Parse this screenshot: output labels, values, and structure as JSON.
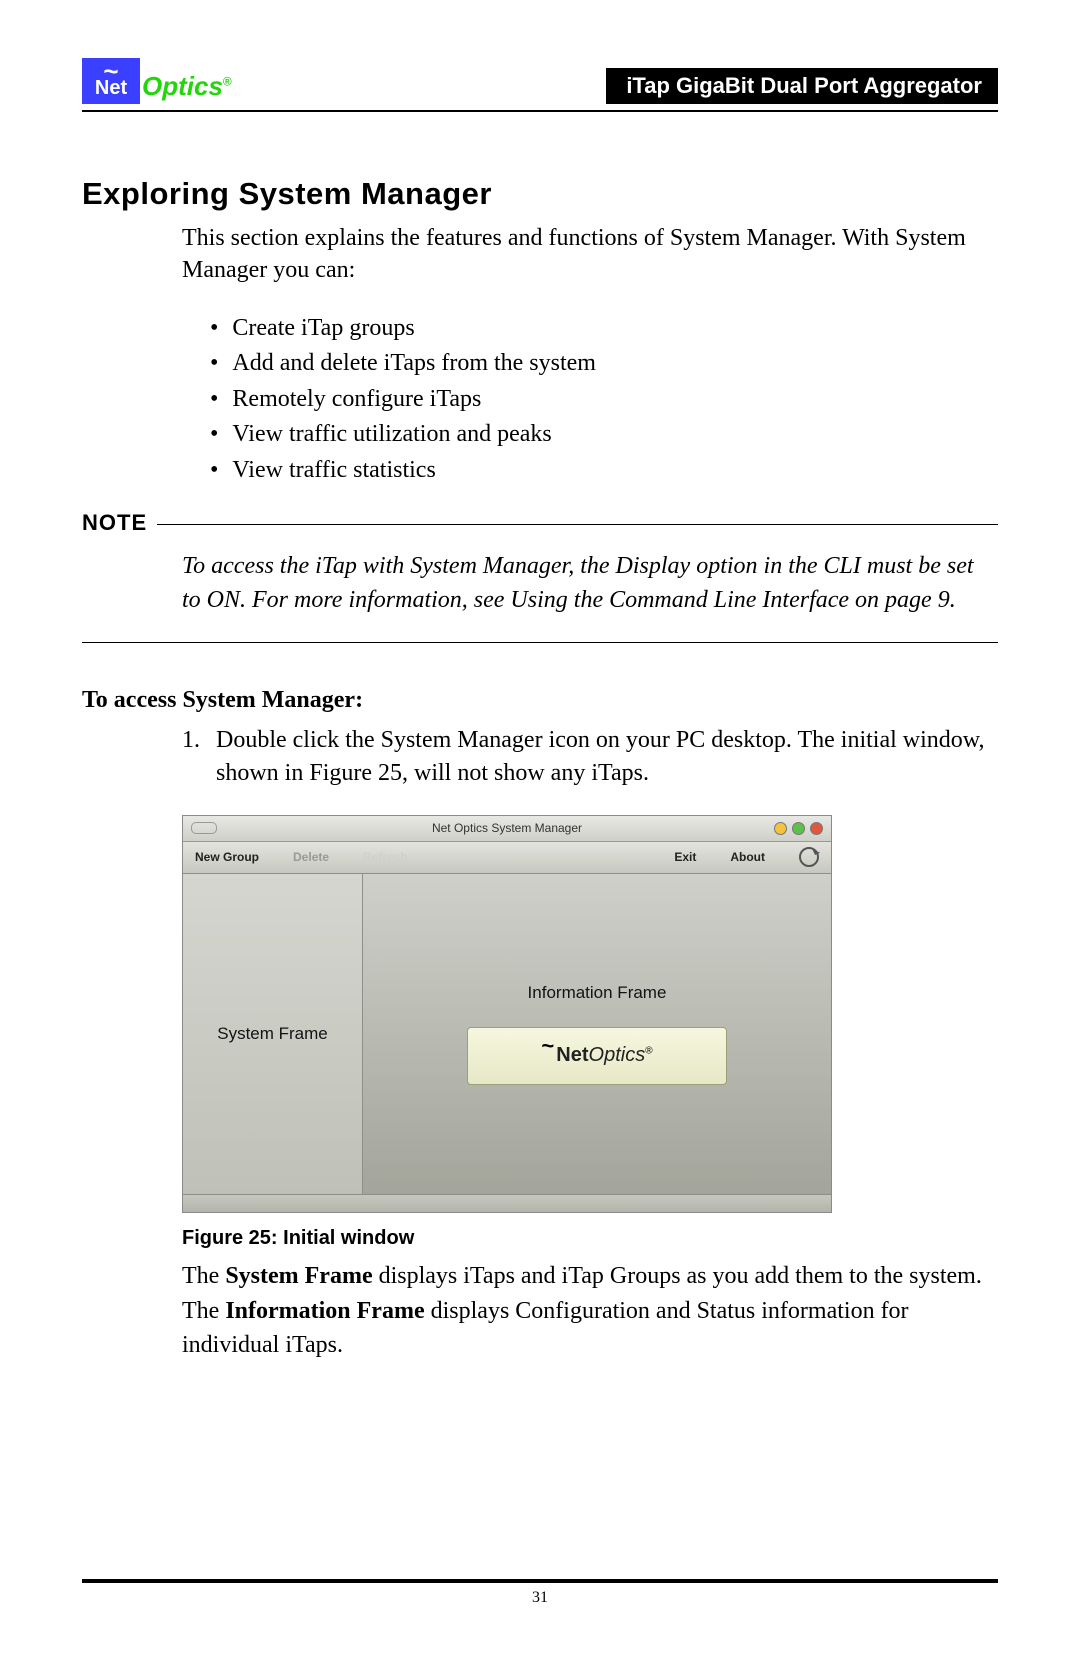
{
  "header": {
    "logo_net": "Net",
    "logo_optics": "Optics",
    "logo_reg": "®",
    "product": "iTap GigaBit Dual Port Aggregator"
  },
  "section_title": "Exploring System Manager",
  "intro": "This section explains the features and functions of System Manager. With System Manager you can:",
  "bullets": [
    "Create iTap groups",
    "Add and delete iTaps from the system",
    "Remotely configure iTaps",
    "View traffic utilization and peaks",
    "View traffic statistics"
  ],
  "note": {
    "label": "NOTE",
    "text": "To access the iTap with System Manager, the Display option in the CLI must be set to ON. For more information, see Using the Command Line Interface on page 9."
  },
  "subhead": "To access System Manager:",
  "step1_num": "1.",
  "step1_text": "Double click the System Manager icon on your PC desktop. The initial window, shown in Figure 25, will not show any iTaps.",
  "window": {
    "title": "Net Optics System Manager",
    "toolbar": {
      "new_group": "New Group",
      "delete": "Delete",
      "refresh": "Refresh",
      "exit": "Exit",
      "about": "About"
    },
    "left_label": "System Frame",
    "right_label": "Information Frame",
    "brand_net": "Net",
    "brand_optics": "Optics",
    "brand_reg": "®"
  },
  "figure": {
    "label": "Figure 25:",
    "title": "Initial window"
  },
  "desc_system_frame_label": "System Frame",
  "desc_info_frame_label": "Information Frame",
  "desc_part1_pre": "The ",
  "desc_part1_post": " displays iTaps and iTap Groups as you add them to the system.",
  "desc_part2_pre": "The ",
  "desc_part2_post": " displays Configuration and Status information for individual iTaps.",
  "page_number": "31"
}
